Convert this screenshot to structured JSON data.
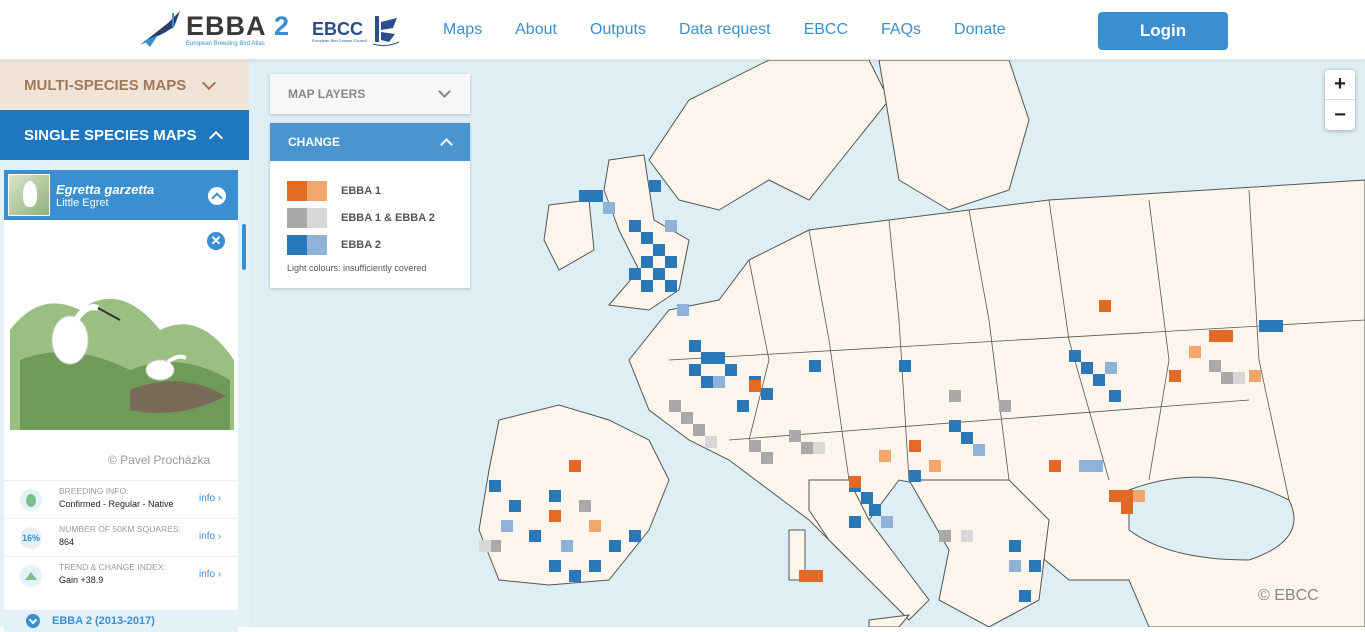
{
  "header": {
    "logo_title": "EBBA",
    "logo_number": "2",
    "logo_subtitle": "European Breeding Bird Atlas",
    "partner_logo": "EBCC",
    "partner_subtitle": "European Bird Census Council",
    "nav": [
      "Maps",
      "About",
      "Outputs",
      "Data request",
      "EBCC",
      "FAQs",
      "Donate"
    ],
    "login_label": "Login"
  },
  "sidebar": {
    "multi_label": "MULTI-SPECIES MAPS",
    "single_label": "SINGLE SPECIES MAPS",
    "species": {
      "scientific": "Egretta garzetta",
      "common": "Little Egret",
      "image_credit": "© Pavel Procházka"
    },
    "info": [
      {
        "icon": "egg-icon",
        "badge": "",
        "label": "BREEDING INFO:",
        "value": "Confirmed - Regular - Native",
        "link": "info"
      },
      {
        "icon": "percent-icon",
        "badge": "16%",
        "label": "NUMBER OF 50KM SQUARES:",
        "value": "864",
        "link": "info"
      },
      {
        "icon": "trend-icon",
        "badge": "",
        "label": "TREND & CHANGE INDEX:",
        "value": "Gain +38.9",
        "link": "info"
      }
    ],
    "period_label": "EBBA 2 (2013-2017)"
  },
  "map": {
    "layers_label": "MAP LAYERS",
    "change_label": "CHANGE",
    "legend": [
      {
        "label": "EBBA 1",
        "dark": "#e06a26",
        "light": "#f2a66e"
      },
      {
        "label": "EBBA 1 & EBBA 2",
        "dark": "#a9a9a9",
        "light": "#d7d7d7"
      },
      {
        "label": "EBBA 2",
        "dark": "#2b78b8",
        "light": "#8fb2d9"
      }
    ],
    "legend_note": "Light colours: insufficiently covered",
    "zoom_in": "+",
    "zoom_out": "−",
    "copyright": "© EBCC",
    "colors": {
      "sea": "#ddeef4",
      "land": "#fbf5ec",
      "border": "#555555"
    }
  }
}
